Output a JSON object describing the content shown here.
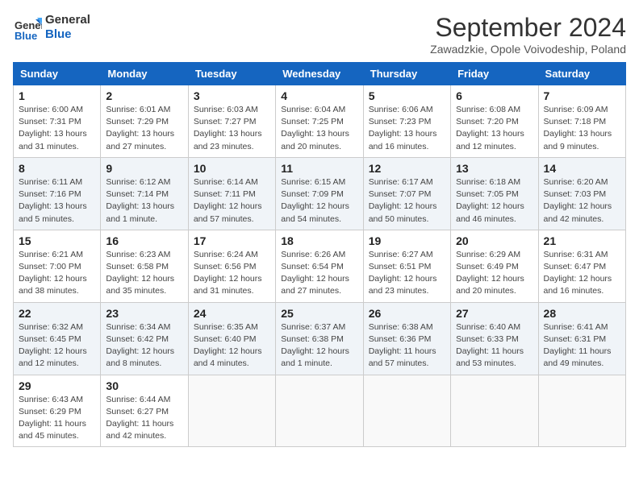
{
  "header": {
    "logo_line1": "General",
    "logo_line2": "Blue",
    "title": "September 2024",
    "subtitle": "Zawadzkie, Opole Voivodeship, Poland"
  },
  "weekdays": [
    "Sunday",
    "Monday",
    "Tuesday",
    "Wednesday",
    "Thursday",
    "Friday",
    "Saturday"
  ],
  "weeks": [
    [
      {
        "day": "1",
        "info": "Sunrise: 6:00 AM\nSunset: 7:31 PM\nDaylight: 13 hours and 31 minutes."
      },
      {
        "day": "2",
        "info": "Sunrise: 6:01 AM\nSunset: 7:29 PM\nDaylight: 13 hours and 27 minutes."
      },
      {
        "day": "3",
        "info": "Sunrise: 6:03 AM\nSunset: 7:27 PM\nDaylight: 13 hours and 23 minutes."
      },
      {
        "day": "4",
        "info": "Sunrise: 6:04 AM\nSunset: 7:25 PM\nDaylight: 13 hours and 20 minutes."
      },
      {
        "day": "5",
        "info": "Sunrise: 6:06 AM\nSunset: 7:23 PM\nDaylight: 13 hours and 16 minutes."
      },
      {
        "day": "6",
        "info": "Sunrise: 6:08 AM\nSunset: 7:20 PM\nDaylight: 13 hours and 12 minutes."
      },
      {
        "day": "7",
        "info": "Sunrise: 6:09 AM\nSunset: 7:18 PM\nDaylight: 13 hours and 9 minutes."
      }
    ],
    [
      {
        "day": "8",
        "info": "Sunrise: 6:11 AM\nSunset: 7:16 PM\nDaylight: 13 hours and 5 minutes."
      },
      {
        "day": "9",
        "info": "Sunrise: 6:12 AM\nSunset: 7:14 PM\nDaylight: 13 hours and 1 minute."
      },
      {
        "day": "10",
        "info": "Sunrise: 6:14 AM\nSunset: 7:11 PM\nDaylight: 12 hours and 57 minutes."
      },
      {
        "day": "11",
        "info": "Sunrise: 6:15 AM\nSunset: 7:09 PM\nDaylight: 12 hours and 54 minutes."
      },
      {
        "day": "12",
        "info": "Sunrise: 6:17 AM\nSunset: 7:07 PM\nDaylight: 12 hours and 50 minutes."
      },
      {
        "day": "13",
        "info": "Sunrise: 6:18 AM\nSunset: 7:05 PM\nDaylight: 12 hours and 46 minutes."
      },
      {
        "day": "14",
        "info": "Sunrise: 6:20 AM\nSunset: 7:03 PM\nDaylight: 12 hours and 42 minutes."
      }
    ],
    [
      {
        "day": "15",
        "info": "Sunrise: 6:21 AM\nSunset: 7:00 PM\nDaylight: 12 hours and 38 minutes."
      },
      {
        "day": "16",
        "info": "Sunrise: 6:23 AM\nSunset: 6:58 PM\nDaylight: 12 hours and 35 minutes."
      },
      {
        "day": "17",
        "info": "Sunrise: 6:24 AM\nSunset: 6:56 PM\nDaylight: 12 hours and 31 minutes."
      },
      {
        "day": "18",
        "info": "Sunrise: 6:26 AM\nSunset: 6:54 PM\nDaylight: 12 hours and 27 minutes."
      },
      {
        "day": "19",
        "info": "Sunrise: 6:27 AM\nSunset: 6:51 PM\nDaylight: 12 hours and 23 minutes."
      },
      {
        "day": "20",
        "info": "Sunrise: 6:29 AM\nSunset: 6:49 PM\nDaylight: 12 hours and 20 minutes."
      },
      {
        "day": "21",
        "info": "Sunrise: 6:31 AM\nSunset: 6:47 PM\nDaylight: 12 hours and 16 minutes."
      }
    ],
    [
      {
        "day": "22",
        "info": "Sunrise: 6:32 AM\nSunset: 6:45 PM\nDaylight: 12 hours and 12 minutes."
      },
      {
        "day": "23",
        "info": "Sunrise: 6:34 AM\nSunset: 6:42 PM\nDaylight: 12 hours and 8 minutes."
      },
      {
        "day": "24",
        "info": "Sunrise: 6:35 AM\nSunset: 6:40 PM\nDaylight: 12 hours and 4 minutes."
      },
      {
        "day": "25",
        "info": "Sunrise: 6:37 AM\nSunset: 6:38 PM\nDaylight: 12 hours and 1 minute."
      },
      {
        "day": "26",
        "info": "Sunrise: 6:38 AM\nSunset: 6:36 PM\nDaylight: 11 hours and 57 minutes."
      },
      {
        "day": "27",
        "info": "Sunrise: 6:40 AM\nSunset: 6:33 PM\nDaylight: 11 hours and 53 minutes."
      },
      {
        "day": "28",
        "info": "Sunrise: 6:41 AM\nSunset: 6:31 PM\nDaylight: 11 hours and 49 minutes."
      }
    ],
    [
      {
        "day": "29",
        "info": "Sunrise: 6:43 AM\nSunset: 6:29 PM\nDaylight: 11 hours and 45 minutes."
      },
      {
        "day": "30",
        "info": "Sunrise: 6:44 AM\nSunset: 6:27 PM\nDaylight: 11 hours and 42 minutes."
      },
      {
        "day": "",
        "info": ""
      },
      {
        "day": "",
        "info": ""
      },
      {
        "day": "",
        "info": ""
      },
      {
        "day": "",
        "info": ""
      },
      {
        "day": "",
        "info": ""
      }
    ]
  ]
}
